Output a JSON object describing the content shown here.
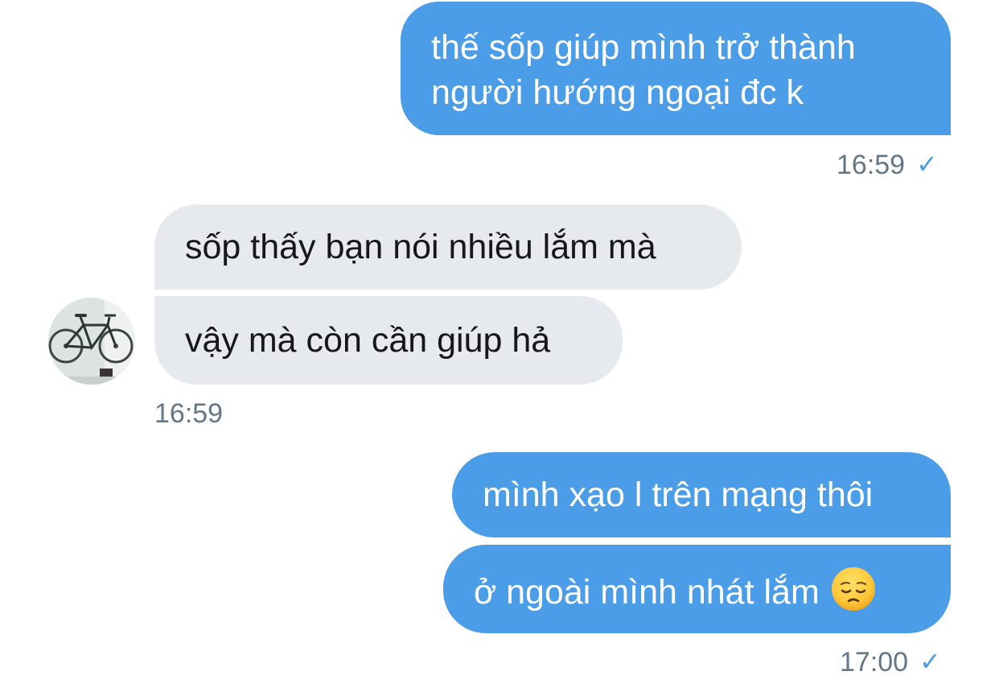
{
  "messages": [
    {
      "direction": "outgoing",
      "lines": [
        "thế sốp giúp mình trở thành",
        "người hướng ngoại đc k"
      ]
    },
    {
      "direction": "incoming",
      "text": "sốp thấy bạn nói nhiều lắm mà"
    },
    {
      "direction": "incoming",
      "text": "vậy mà còn cần giúp hả"
    },
    {
      "direction": "outgoing",
      "text": "mình xạo l trên mạng thôi"
    },
    {
      "direction": "outgoing",
      "text": "ở ngoài mình nhát lắm",
      "emoji": "pensive-face-emoji"
    }
  ],
  "timestamps": {
    "first_outgoing": "16:59",
    "incoming": "16:59",
    "second_outgoing": "17:00"
  },
  "status": {
    "read_check": "✓",
    "check_color": "#4b9de8"
  },
  "avatar": {
    "icon": "bicycle-avatar-icon"
  },
  "colors": {
    "outgoing_bubble": "#4b9de8",
    "incoming_bubble": "#e6e9ee",
    "timestamp_text": "#657786"
  }
}
